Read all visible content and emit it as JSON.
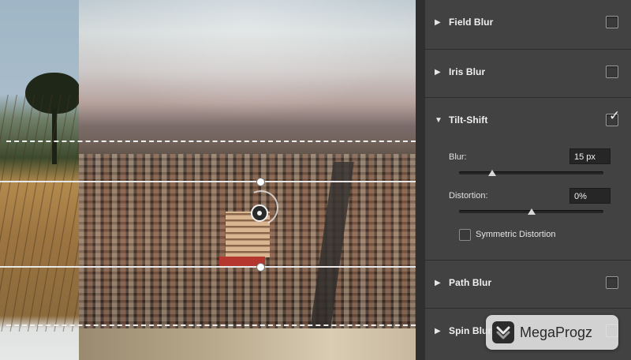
{
  "panel": {
    "sections": [
      {
        "title": "Field Blur",
        "expanded": false,
        "checked": false
      },
      {
        "title": "Iris Blur",
        "expanded": false,
        "checked": false
      },
      {
        "title": "Tilt-Shift",
        "expanded": true,
        "checked": true
      },
      {
        "title": "Path Blur",
        "expanded": false,
        "checked": false
      },
      {
        "title": "Spin Blur",
        "expanded": false,
        "checked": false
      }
    ],
    "tilt_shift": {
      "blur_label": "Blur:",
      "blur_value": "15 px",
      "blur_slider_level": 0.23,
      "distortion_label": "Distortion:",
      "distortion_value": "0%",
      "distortion_slider_level": 0.5,
      "symmetric_label": "Symmetric Distortion",
      "symmetric_checked": false
    }
  },
  "glyphs": {
    "arrow_collapsed": "▶",
    "arrow_expanded": "▼",
    "checkmark": "✓"
  },
  "watermark": {
    "text": "MegaProgz"
  },
  "colors": {
    "panel_bg": "#424242",
    "panel_border": "#2f2f2f",
    "text": "#f0f0f0",
    "guide": "#eeeeee"
  },
  "icons": {
    "expand": "triangle-right-icon",
    "collapse": "triangle-down-icon",
    "blur_pin": "blur-pin-icon",
    "watermark_logo": "megaprogz-logo-icon"
  }
}
